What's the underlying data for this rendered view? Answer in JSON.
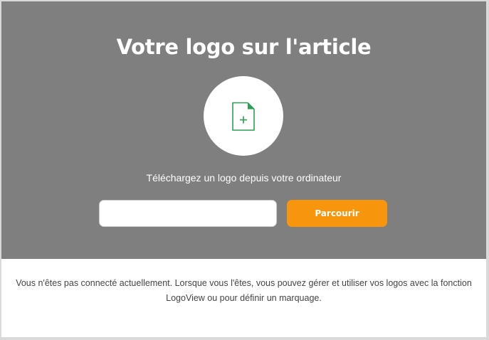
{
  "dialog": {
    "title": "Votre logo sur l'article",
    "upload_icon": "file-add-icon",
    "upload_hint": "Téléchargez un logo depuis votre ordinateur",
    "file_input_value": "",
    "browse_label": "Parcourir",
    "notice": "Vous n'êtes pas connecté actuellement. Lorsque vous l'êtes, vous pouvez gérer et utiliser vos logos avec la fonction LogoView ou pour définir un marquage."
  },
  "colors": {
    "panel_background": "#7f7f7f",
    "accent": "#f7960c",
    "icon_green": "#2e9e57"
  }
}
